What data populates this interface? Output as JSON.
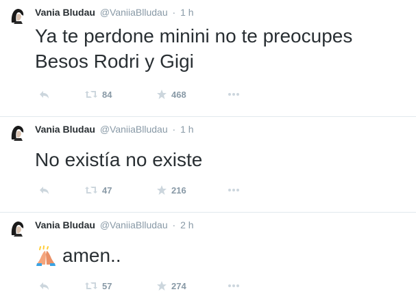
{
  "tweets": [
    {
      "fullname": "Vania Bludau",
      "handle": "@VaniiaBlludau",
      "separator": "·",
      "time": "1 h",
      "text": "Ya te perdone minini no te preocupes Besos Rodri y Gigi",
      "text_line1": "Ya te perdone minini no te preocupes",
      "text_line2": "Besos Rodri y Gigi",
      "retweets": "84",
      "favorites": "468"
    },
    {
      "fullname": "Vania Bludau",
      "handle": "@VaniiaBlludau",
      "separator": "·",
      "time": "1 h",
      "text": "No existía no existe",
      "retweets": "47",
      "favorites": "216"
    },
    {
      "fullname": "Vania Bludau",
      "handle": "@VaniiaBlludau",
      "separator": "·",
      "time": "2 h",
      "emoji": "folded-hands-emoji",
      "text": "amen..",
      "retweets": "57",
      "favorites": "274"
    }
  ],
  "icons": {
    "reply": "reply-icon",
    "retweet": "retweet-icon",
    "favorite": "star-icon",
    "more": "more-icon"
  },
  "colors": {
    "text": "#292f33",
    "muted": "#8899a6",
    "icon": "#ccd6dd",
    "divider": "#e1e8ed"
  }
}
